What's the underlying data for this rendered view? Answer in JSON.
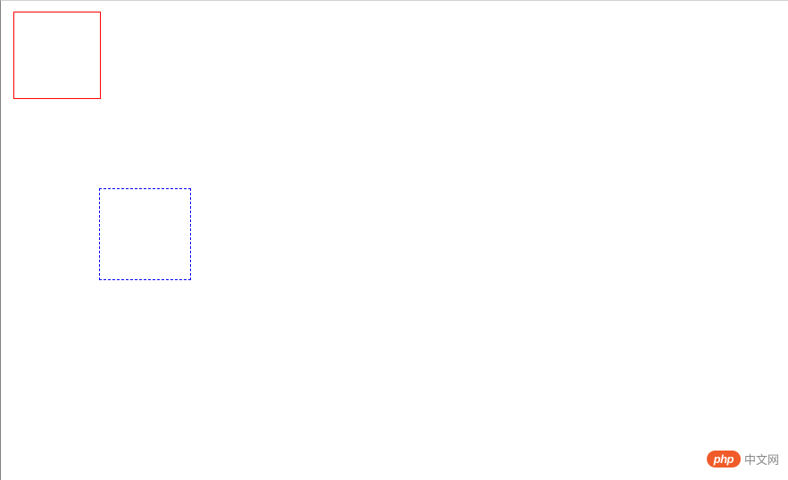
{
  "boxes": {
    "red": {
      "border_color": "#ff0000",
      "border_style": "solid"
    },
    "blue": {
      "border_color": "#0000ff",
      "border_style": "dashed"
    }
  },
  "watermark": {
    "badge": "php",
    "text": "中文网"
  }
}
